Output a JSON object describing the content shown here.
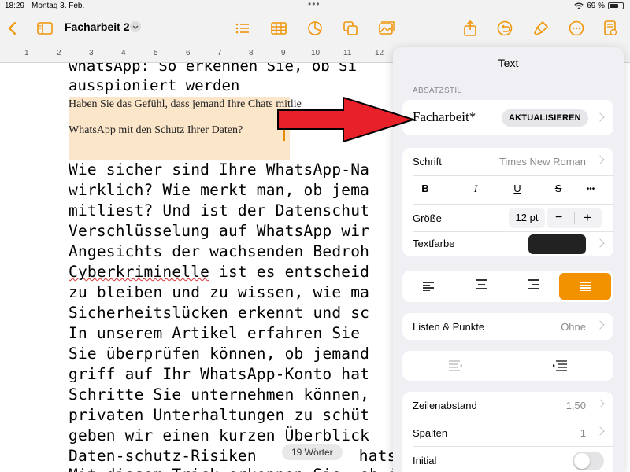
{
  "status": {
    "time": "18:29",
    "date": "Montag 3. Feb.",
    "dots": "•••",
    "battery": "69 %",
    "battery_level": 0.69
  },
  "toolbar": {
    "title": "Facharbeit 2"
  },
  "ruler": {
    "ticks": [
      "1",
      "2",
      "3",
      "4",
      "5",
      "6",
      "7",
      "8",
      "9",
      "10",
      "11",
      "12"
    ]
  },
  "document": {
    "heading_lines": [
      "whatsApp: So erkennen Sie, ob Si",
      "ausspioniert werden"
    ],
    "selected_lines": [
      "Haben Sie das Gefühl, dass jemand Ihre Chats mitlie",
      "WhatsApp mit den Schutz Ihrer Daten?"
    ],
    "body_lines": [
      "Wie sicher sind Ihre WhatsApp-Na",
      "wirklich? Wie merkt man, ob jema",
      "mitliest? Und ist der Datenschut",
      "Verschlüsselung auf WhatsApp wir",
      "Angesichts der wachsenden Bedroh",
      "Cyberkriminelle",
      " ist es entscheid",
      "zu bleiben und zu wissen, wie ma",
      "Sicherheitslücken erkennt und sc",
      "In unserem Artikel erfahren Sie",
      "Sie überprüfen können, ob jemand",
      "griff auf Ihr WhatsApp-Konto hat",
      "Schritte Sie unternehmen können,",
      "privaten Unterhaltungen zu schüt",
      "geben wir einen kurzen Überblick",
      "Daten-schutz-Risiken ",
      "hatsAp",
      "Mit diesem Trick erkennen Sie, ob jemand"
    ],
    "word_count": "19 Wörter"
  },
  "panel": {
    "title": "Text",
    "section_label": "ABSATZSTIL",
    "style_name": "Facharbeit*",
    "update_button": "AKTUALISIEREN",
    "font_label": "Schrift",
    "font_value": "Times New Roman",
    "bold": "B",
    "italic": "I",
    "underline": "U",
    "strike": "S",
    "more": "•••",
    "size_label": "Größe",
    "size_value": "12 pt",
    "minus": "−",
    "plus": "+",
    "color_label": "Textfarbe",
    "text_color": "#222222",
    "lists_label": "Listen & Punkte",
    "lists_value": "Ohne",
    "line_spacing_label": "Zeilenabstand",
    "line_spacing_value": "1,50",
    "columns_label": "Spalten",
    "columns_value": "1",
    "initial_label": "Initial"
  },
  "colors": {
    "accent": "#f39200",
    "selection": "#fce6c9",
    "arrow": "#e8202a"
  }
}
